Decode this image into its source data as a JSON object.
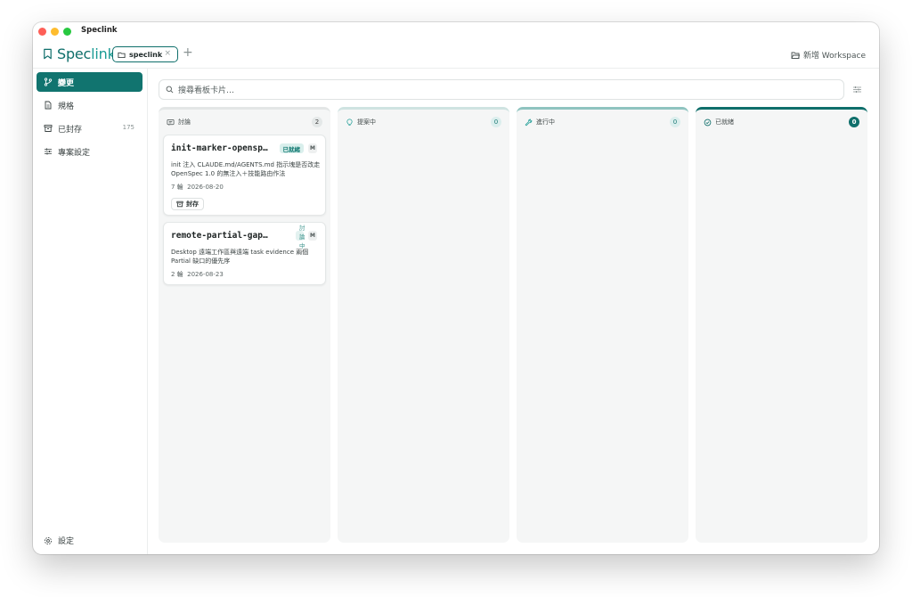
{
  "window": {
    "title": "Speclink"
  },
  "header": {
    "brand_prefix": "Spec",
    "brand_suffix": "link",
    "tab_label": "speclink",
    "tab_close": "×",
    "tab_add": "+",
    "new_workspace": "新增 Workspace"
  },
  "sidebar": {
    "items": [
      {
        "label": "變更",
        "icon": "git-branch-icon",
        "count": ""
      },
      {
        "label": "規格",
        "icon": "document-icon",
        "count": ""
      },
      {
        "label": "已封存",
        "icon": "archive-icon",
        "count": "175"
      },
      {
        "label": "專案設定",
        "icon": "sliders-icon",
        "count": ""
      }
    ],
    "settings_label": "設定"
  },
  "search": {
    "placeholder": "搜尋看板卡片…"
  },
  "columns": [
    {
      "title": "討論",
      "count": "2",
      "icon": "chat-icon"
    },
    {
      "title": "提案中",
      "count": "0",
      "icon": "lightbulb-icon"
    },
    {
      "title": "進行中",
      "count": "0",
      "icon": "wrench-icon"
    },
    {
      "title": "已就緒",
      "count": "0",
      "icon": "check-circle-icon"
    }
  ],
  "cards": [
    {
      "title": "init-marker-opensp…",
      "badge": "已就緒",
      "size": "M",
      "desc": "init 注入 CLAUDE.md/AGENTS.md 指示塊是否改走 OpenSpec 1.0 的無注入＋技能路由作法",
      "rounds": "7 輪",
      "date": "2026-08-20",
      "action": "封存"
    },
    {
      "title": "remote-partial-gap…",
      "badge": "討論中",
      "size": "M",
      "desc": "Desktop 遠端工作區與遠端 task evidence 兩個 Partial 缺口的優先序",
      "rounds": "2 輪",
      "date": "2026-08-23"
    }
  ],
  "colors": {
    "accent": "#0f6f6b",
    "accent_light": "#1a9b94",
    "badge_bg": "#d9efec"
  }
}
